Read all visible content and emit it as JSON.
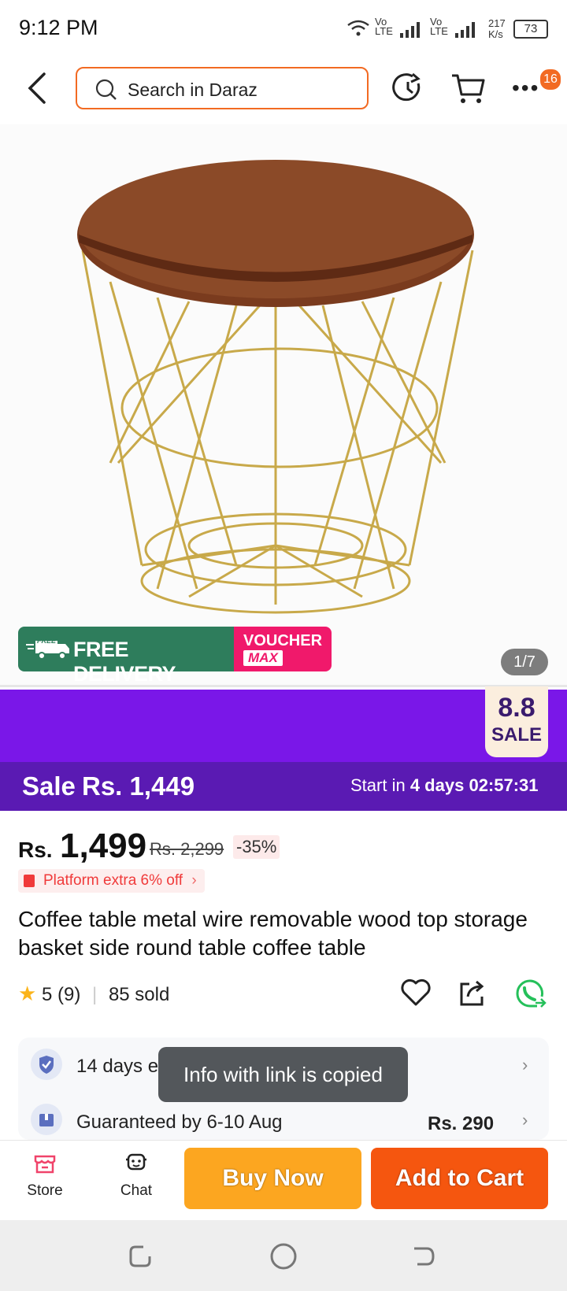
{
  "status_bar": {
    "time": "9:12 PM",
    "net1": "Vo LTE",
    "net2": "Vo LTE",
    "speed": "217",
    "speed_unit": "K/s",
    "battery": "73"
  },
  "header": {
    "search_placeholder": "Search in Daraz",
    "cart_badge": "16"
  },
  "gallery": {
    "counter": "1/7",
    "free_tag": "FREE",
    "delivery_label": "FREE DELIVERY",
    "voucher_top": "VOUCHER",
    "voucher_bottom": "MAX"
  },
  "sale": {
    "badge_num": "8.8",
    "badge_word": "SALE",
    "label": "Sale",
    "price": "Rs. 1,449",
    "countdown_prefix": "Start in",
    "countdown_days": "4 days",
    "countdown_time": "02:57:31"
  },
  "product": {
    "currency": "Rs.",
    "price": "1,499",
    "old_price": "Rs. 2,299",
    "discount": "-35%",
    "platform_offer": "Platform extra 6% off",
    "title": "Coffee table metal wire removable wood top storage basket side round table coffee table",
    "rating": "5",
    "review_count": "(9)",
    "sold": "85 sold"
  },
  "services": {
    "return_label": "14 days easy return",
    "delivery_label": "Guaranteed by 6-10 Aug",
    "delivery_fee": "Rs. 290"
  },
  "toast": "Info with link is copied",
  "bottom_bar": {
    "store": "Store",
    "chat": "Chat",
    "buy_now": "Buy Now",
    "add_to_cart": "Add to Cart"
  },
  "colors": {
    "accent": "#f26a22",
    "sale_purple": "#7a17e8",
    "buy_now": "#fca620",
    "add_to_cart": "#f5560f",
    "whatsapp": "#25c05a"
  }
}
